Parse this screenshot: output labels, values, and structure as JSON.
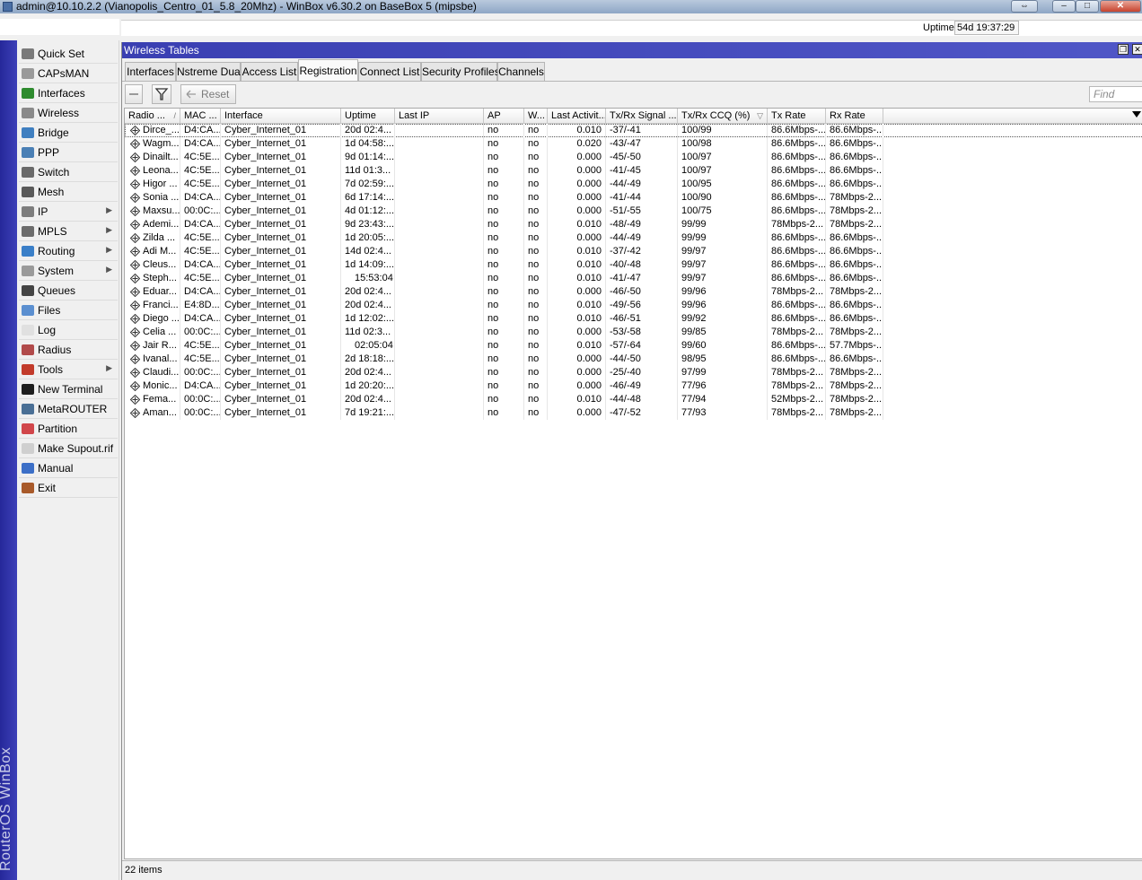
{
  "window": {
    "title": "admin@10.10.2.2 (Vianopolis_Centro_01_5.8_20Mhz) - WinBox v6.30.2 on BaseBox 5 (mipsbe)",
    "buttons": {
      "restore": "⇔",
      "minimize": "–",
      "maximize": "□",
      "close": "✕"
    }
  },
  "topbar": {
    "uptime_label": "Uptime:",
    "uptime_value": "54d 19:37:29"
  },
  "brand": "RouterOS WinBox",
  "sidebar": {
    "items": [
      {
        "label": "Quick Set",
        "icon": "quick-set-icon",
        "color": "#7a7a7a",
        "submenu": false
      },
      {
        "label": "CAPsMAN",
        "icon": "capsman-icon",
        "color": "#9a9a9a",
        "submenu": false
      },
      {
        "label": "Interfaces",
        "icon": "interfaces-icon",
        "color": "#2e8b2e",
        "submenu": false
      },
      {
        "label": "Wireless",
        "icon": "wireless-icon",
        "color": "#8a8a8a",
        "submenu": false
      },
      {
        "label": "Bridge",
        "icon": "bridge-icon",
        "color": "#3f7fc0",
        "submenu": false
      },
      {
        "label": "PPP",
        "icon": "ppp-icon",
        "color": "#4a7fb5",
        "submenu": false
      },
      {
        "label": "Switch",
        "icon": "switch-icon",
        "color": "#6a6a6a",
        "submenu": false
      },
      {
        "label": "Mesh",
        "icon": "mesh-icon",
        "color": "#5a5a5a",
        "submenu": false
      },
      {
        "label": "IP",
        "icon": "ip-icon",
        "color": "#7d7d7d",
        "submenu": true
      },
      {
        "label": "MPLS",
        "icon": "mpls-icon",
        "color": "#6c6c6c",
        "submenu": true
      },
      {
        "label": "Routing",
        "icon": "routing-icon",
        "color": "#3a7fc8",
        "submenu": true
      },
      {
        "label": "System",
        "icon": "system-icon",
        "color": "#9a9a9a",
        "submenu": true
      },
      {
        "label": "Queues",
        "icon": "queues-icon",
        "color": "#444444",
        "submenu": false
      },
      {
        "label": "Files",
        "icon": "files-icon",
        "color": "#5b8fd0",
        "submenu": false
      },
      {
        "label": "Log",
        "icon": "log-icon",
        "color": "#e0e0e0",
        "submenu": false
      },
      {
        "label": "Radius",
        "icon": "radius-icon",
        "color": "#b14a4a",
        "submenu": false
      },
      {
        "label": "Tools",
        "icon": "tools-icon",
        "color": "#c23b2b",
        "submenu": true
      },
      {
        "label": "New Terminal",
        "icon": "terminal-icon",
        "color": "#1e1e1e",
        "submenu": false
      },
      {
        "label": "MetaROUTER",
        "icon": "metarouter-icon",
        "color": "#4a6f95",
        "submenu": false
      },
      {
        "label": "Partition",
        "icon": "partition-icon",
        "color": "#d1464a",
        "submenu": false
      },
      {
        "label": "Make Supout.rif",
        "icon": "supout-icon",
        "color": "#cfcfcf",
        "submenu": false
      },
      {
        "label": "Manual",
        "icon": "manual-icon",
        "color": "#3c6fc7",
        "submenu": false
      },
      {
        "label": "Exit",
        "icon": "exit-icon",
        "color": "#a85a2a",
        "submenu": false
      }
    ]
  },
  "main": {
    "title": "Wireless Tables",
    "title_buttons": {
      "restore": "❐",
      "close": "✕"
    },
    "tabs": [
      {
        "label": "Interfaces",
        "active": false
      },
      {
        "label": "Nstreme Dual",
        "active": false
      },
      {
        "label": "Access List",
        "active": false
      },
      {
        "label": "Registration",
        "active": true
      },
      {
        "label": "Connect List",
        "active": false
      },
      {
        "label": "Security Profiles",
        "active": false
      },
      {
        "label": "Channels",
        "active": false
      }
    ],
    "toolbar": {
      "reset_label": "Reset",
      "find_placeholder": "Find"
    },
    "columns": [
      "Radio ...",
      "MAC ...",
      "Interface",
      "Uptime",
      "Last IP",
      "AP",
      "W...",
      "Last Activit...",
      "Tx/Rx Signal ...",
      "Tx/Rx CCQ (%)",
      "Tx Rate",
      "Rx Rate"
    ],
    "rows": [
      [
        "Dirce_...",
        "D4:CA...",
        "Cyber_Internet_01",
        "20d 02:4...",
        "",
        "no",
        "no",
        "0.010",
        "-37/-41",
        "100/99",
        "86.6Mbps-...",
        "86.6Mbps-..."
      ],
      [
        "Wagm...",
        "D4:CA...",
        "Cyber_Internet_01",
        "1d 04:58:...",
        "",
        "no",
        "no",
        "0.020",
        "-43/-47",
        "100/98",
        "86.6Mbps-...",
        "86.6Mbps-..."
      ],
      [
        "Dinailt...",
        "4C:5E...",
        "Cyber_Internet_01",
        "9d 01:14:...",
        "",
        "no",
        "no",
        "0.000",
        "-45/-50",
        "100/97",
        "86.6Mbps-...",
        "86.6Mbps-..."
      ],
      [
        "Leona...",
        "4C:5E...",
        "Cyber_Internet_01",
        "11d 01:3...",
        "",
        "no",
        "no",
        "0.000",
        "-41/-45",
        "100/97",
        "86.6Mbps-...",
        "86.6Mbps-..."
      ],
      [
        "Higor ...",
        "4C:5E...",
        "Cyber_Internet_01",
        "7d 02:59:...",
        "",
        "no",
        "no",
        "0.000",
        "-44/-49",
        "100/95",
        "86.6Mbps-...",
        "86.6Mbps-..."
      ],
      [
        "Sonia ...",
        "D4:CA...",
        "Cyber_Internet_01",
        "6d 17:14:...",
        "",
        "no",
        "no",
        "0.000",
        "-41/-44",
        "100/90",
        "86.6Mbps-...",
        "78Mbps-2..."
      ],
      [
        "Maxsu...",
        "00:0C:...",
        "Cyber_Internet_01",
        "4d 01:12:...",
        "",
        "no",
        "no",
        "0.000",
        "-51/-55",
        "100/75",
        "86.6Mbps-...",
        "78Mbps-2..."
      ],
      [
        "Ademi...",
        "D4:CA...",
        "Cyber_Internet_01",
        "9d 23:43:...",
        "",
        "no",
        "no",
        "0.010",
        "-48/-49",
        "99/99",
        "78Mbps-2...",
        "78Mbps-2..."
      ],
      [
        "Zilda ...",
        "4C:5E...",
        "Cyber_Internet_01",
        "1d 20:05:...",
        "",
        "no",
        "no",
        "0.000",
        "-44/-49",
        "99/99",
        "86.6Mbps-...",
        "86.6Mbps-..."
      ],
      [
        "Adi M...",
        "4C:5E...",
        "Cyber_Internet_01",
        "14d 02:4...",
        "",
        "no",
        "no",
        "0.010",
        "-37/-42",
        "99/97",
        "86.6Mbps-...",
        "86.6Mbps-..."
      ],
      [
        "Cleus...",
        "D4:CA...",
        "Cyber_Internet_01",
        "1d 14:09:...",
        "",
        "no",
        "no",
        "0.010",
        "-40/-48",
        "99/97",
        "86.6Mbps-...",
        "86.6Mbps-..."
      ],
      [
        "Steph...",
        "4C:5E...",
        "Cyber_Internet_01",
        "15:53:04",
        "",
        "no",
        "no",
        "0.010",
        "-41/-47",
        "99/97",
        "86.6Mbps-...",
        "86.6Mbps-..."
      ],
      [
        "Eduar...",
        "D4:CA...",
        "Cyber_Internet_01",
        "20d 02:4...",
        "",
        "no",
        "no",
        "0.000",
        "-46/-50",
        "99/96",
        "78Mbps-2...",
        "78Mbps-2..."
      ],
      [
        "Franci...",
        "E4:8D...",
        "Cyber_Internet_01",
        "20d 02:4...",
        "",
        "no",
        "no",
        "0.010",
        "-49/-56",
        "99/96",
        "86.6Mbps-...",
        "86.6Mbps-..."
      ],
      [
        "Diego ...",
        "D4:CA...",
        "Cyber_Internet_01",
        "1d 12:02:...",
        "",
        "no",
        "no",
        "0.010",
        "-46/-51",
        "99/92",
        "86.6Mbps-...",
        "86.6Mbps-..."
      ],
      [
        "Celia ...",
        "00:0C:...",
        "Cyber_Internet_01",
        "11d 02:3...",
        "",
        "no",
        "no",
        "0.000",
        "-53/-58",
        "99/85",
        "78Mbps-2...",
        "78Mbps-2..."
      ],
      [
        "Jair R...",
        "4C:5E...",
        "Cyber_Internet_01",
        "02:05:04",
        "",
        "no",
        "no",
        "0.010",
        "-57/-64",
        "99/60",
        "86.6Mbps-...",
        "57.7Mbps-..."
      ],
      [
        "Ivanal...",
        "4C:5E...",
        "Cyber_Internet_01",
        "2d 18:18:...",
        "",
        "no",
        "no",
        "0.000",
        "-44/-50",
        "98/95",
        "86.6Mbps-...",
        "86.6Mbps-..."
      ],
      [
        "Claudi...",
        "00:0C:...",
        "Cyber_Internet_01",
        "20d 02:4...",
        "",
        "no",
        "no",
        "0.000",
        "-25/-40",
        "97/99",
        "78Mbps-2...",
        "78Mbps-2..."
      ],
      [
        "Monic...",
        "D4:CA...",
        "Cyber_Internet_01",
        "1d 20:20:...",
        "",
        "no",
        "no",
        "0.000",
        "-46/-49",
        "77/96",
        "78Mbps-2...",
        "78Mbps-2..."
      ],
      [
        "Fema...",
        "00:0C:...",
        "Cyber_Internet_01",
        "20d 02:4...",
        "",
        "no",
        "no",
        "0.010",
        "-44/-48",
        "77/94",
        "52Mbps-2...",
        "78Mbps-2..."
      ],
      [
        "Aman...",
        "00:0C:...",
        "Cyber_Internet_01",
        "7d 19:21:...",
        "",
        "no",
        "no",
        "0.000",
        "-47/-52",
        "77/93",
        "78Mbps-2...",
        "78Mbps-2..."
      ]
    ],
    "status": "22 items"
  }
}
